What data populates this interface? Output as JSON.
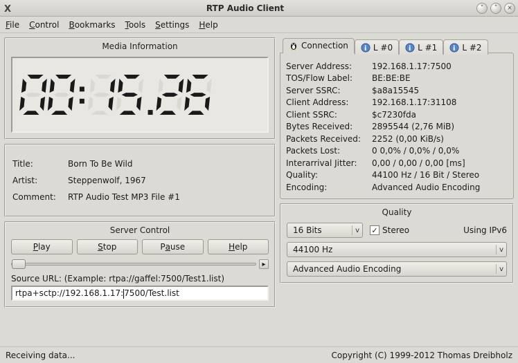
{
  "window": {
    "title": "RTP Audio Client"
  },
  "menubar": {
    "items": [
      "File",
      "Control",
      "Bookmarks",
      "Tools",
      "Settings",
      "Help"
    ]
  },
  "media": {
    "panel_title": "Media Information",
    "time": "00:15.26",
    "title_label": "Title:",
    "title_value": "Born To Be Wild",
    "artist_label": "Artist:",
    "artist_value": "Steppenwolf, 1967",
    "comment_label": "Comment:",
    "comment_value": "RTP Audio Test MP3 File #1"
  },
  "tabs": {
    "connection": "Connection",
    "l0": "L #0",
    "l1": "L #1",
    "l2": "L #2"
  },
  "conn": {
    "server_address_k": "Server Address:",
    "server_address_v": "192.168.1.17:7500",
    "tos_k": "TOS/Flow Label:",
    "tos_v": "BE:BE:BE",
    "server_ssrc_k": "Server SSRC:",
    "server_ssrc_v": "$a8a15545",
    "client_address_k": "Client Address:",
    "client_address_v": "192.168.1.17:31108",
    "client_ssrc_k": "Client SSRC:",
    "client_ssrc_v": "$c7230fda",
    "bytes_k": "Bytes Received:",
    "bytes_v": "2895544 (2,76 MiB)",
    "packets_k": "Packets Received:",
    "packets_v": "2252 (0,00 KiB/s)",
    "lost_k": "Packets Lost:",
    "lost_v": "0 0,0% / 0,0% / 0,0%",
    "jitter_k": "Interarrival Jitter:",
    "jitter_v": "0,00 / 0,00 / 0,00 [ms]",
    "quality_k": "Quality:",
    "quality_v": "44100 Hz / 16 Bit / Stereo",
    "encoding_k": "Encoding:",
    "encoding_v": "Advanced Audio Encoding"
  },
  "server_control": {
    "panel_title": "Server Control",
    "play": "Play",
    "stop": "Stop",
    "pause": "Pause",
    "help": "Help",
    "source_label": "Source URL: (Example: rtpa://gaffel:7500/Test1.list)",
    "source_value_pre": "rtpa+sctp://192.168.1.17:",
    "source_value_post": "7500/Test.list",
    "source_value": "rtpa+sctp://192.168.1.17:7500/Test.list"
  },
  "quality": {
    "panel_title": "Quality",
    "bits": "16 Bits",
    "stereo_label": "Stereo",
    "ipv6_label": "Using IPv6",
    "rate": "44100 Hz",
    "encoding": "Advanced Audio Encoding"
  },
  "status": {
    "left": "Receiving data...",
    "right": "Copyright (C) 1999-2012 Thomas Dreibholz"
  }
}
